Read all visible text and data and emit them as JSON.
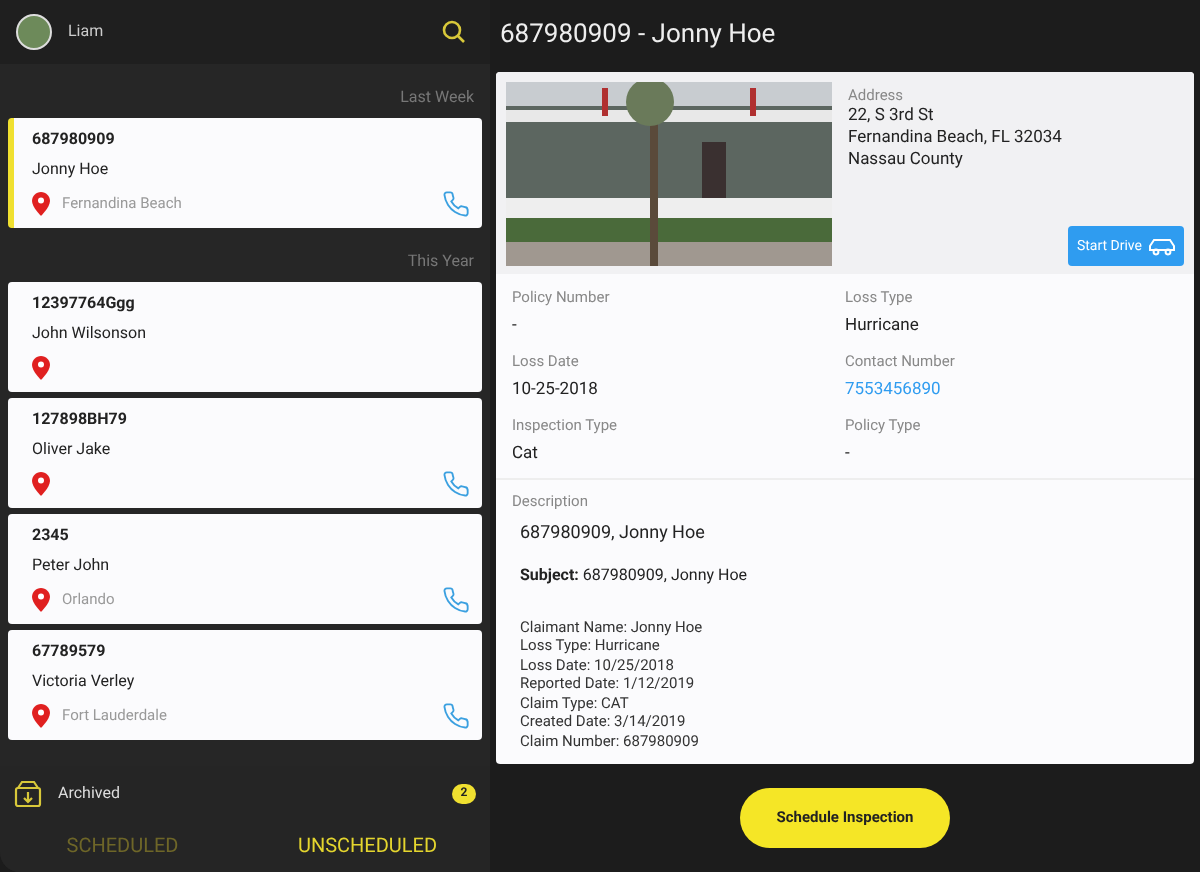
{
  "sidebar": {
    "user": {
      "name": "Liam"
    },
    "groups": [
      {
        "heading": "Last Week",
        "claims": [
          {
            "number": "687980909",
            "name": "Jonny Hoe",
            "city": "Fernandina Beach",
            "phone": true,
            "selected": true
          }
        ]
      },
      {
        "heading": "This Year",
        "claims": [
          {
            "number": "12397764Ggg",
            "name": "John Wilsonson",
            "phone": false,
            "selected": false
          },
          {
            "number": "127898BH79",
            "name": "Oliver Jake",
            "phone": true,
            "selected": false
          },
          {
            "number": "2345",
            "name": "Peter John",
            "city": "Orlando",
            "phone": true,
            "selected": false
          },
          {
            "number": "67789579",
            "name": "Victoria Verley",
            "city": "Fort Lauderdale",
            "phone": true,
            "selected": false
          }
        ]
      }
    ],
    "archived": {
      "label": "Archived",
      "count": "2"
    },
    "tabs": [
      {
        "label": "SCHEDULED",
        "selected": false
      },
      {
        "label": "UNSCHEDULED",
        "selected": true
      }
    ]
  },
  "detail": {
    "title": "687980909 - Jonny Hoe",
    "address": {
      "label": "Address",
      "lines": [
        "22, S 3rd St",
        "Fernandina Beach, FL 32034",
        "Nassau County"
      ]
    },
    "start_drive": "Start Drive",
    "fields": [
      {
        "label": "Policy Number",
        "value": "-",
        "kind": "text"
      },
      {
        "label": "Loss Type",
        "value": "Hurricane",
        "kind": "text"
      },
      {
        "label": "Loss Date",
        "value": "10-25-2018",
        "kind": "text"
      },
      {
        "label": "Contact Number",
        "value": "7553456890",
        "kind": "link"
      },
      {
        "label": "Inspection Type",
        "value": "Cat",
        "kind": "text"
      },
      {
        "label": "Policy Type",
        "value": "-",
        "kind": "text"
      }
    ],
    "description": {
      "label": "Description",
      "heading": "687980909, Jonny Hoe",
      "subject": "**Subject:** 687980909, Jonny Hoe",
      "lines": [
        "Claimant Name: Jonny Hoe",
        "Loss Type: Hurricane",
        "Loss Date: 10/25/2018",
        "Reported Date: 1/12/2019",
        "Claim Type: CAT",
        "Created Date: 3/14/2019",
        "Claim Number: 687980909"
      ]
    },
    "schedule_button": "Schedule Inspection"
  }
}
